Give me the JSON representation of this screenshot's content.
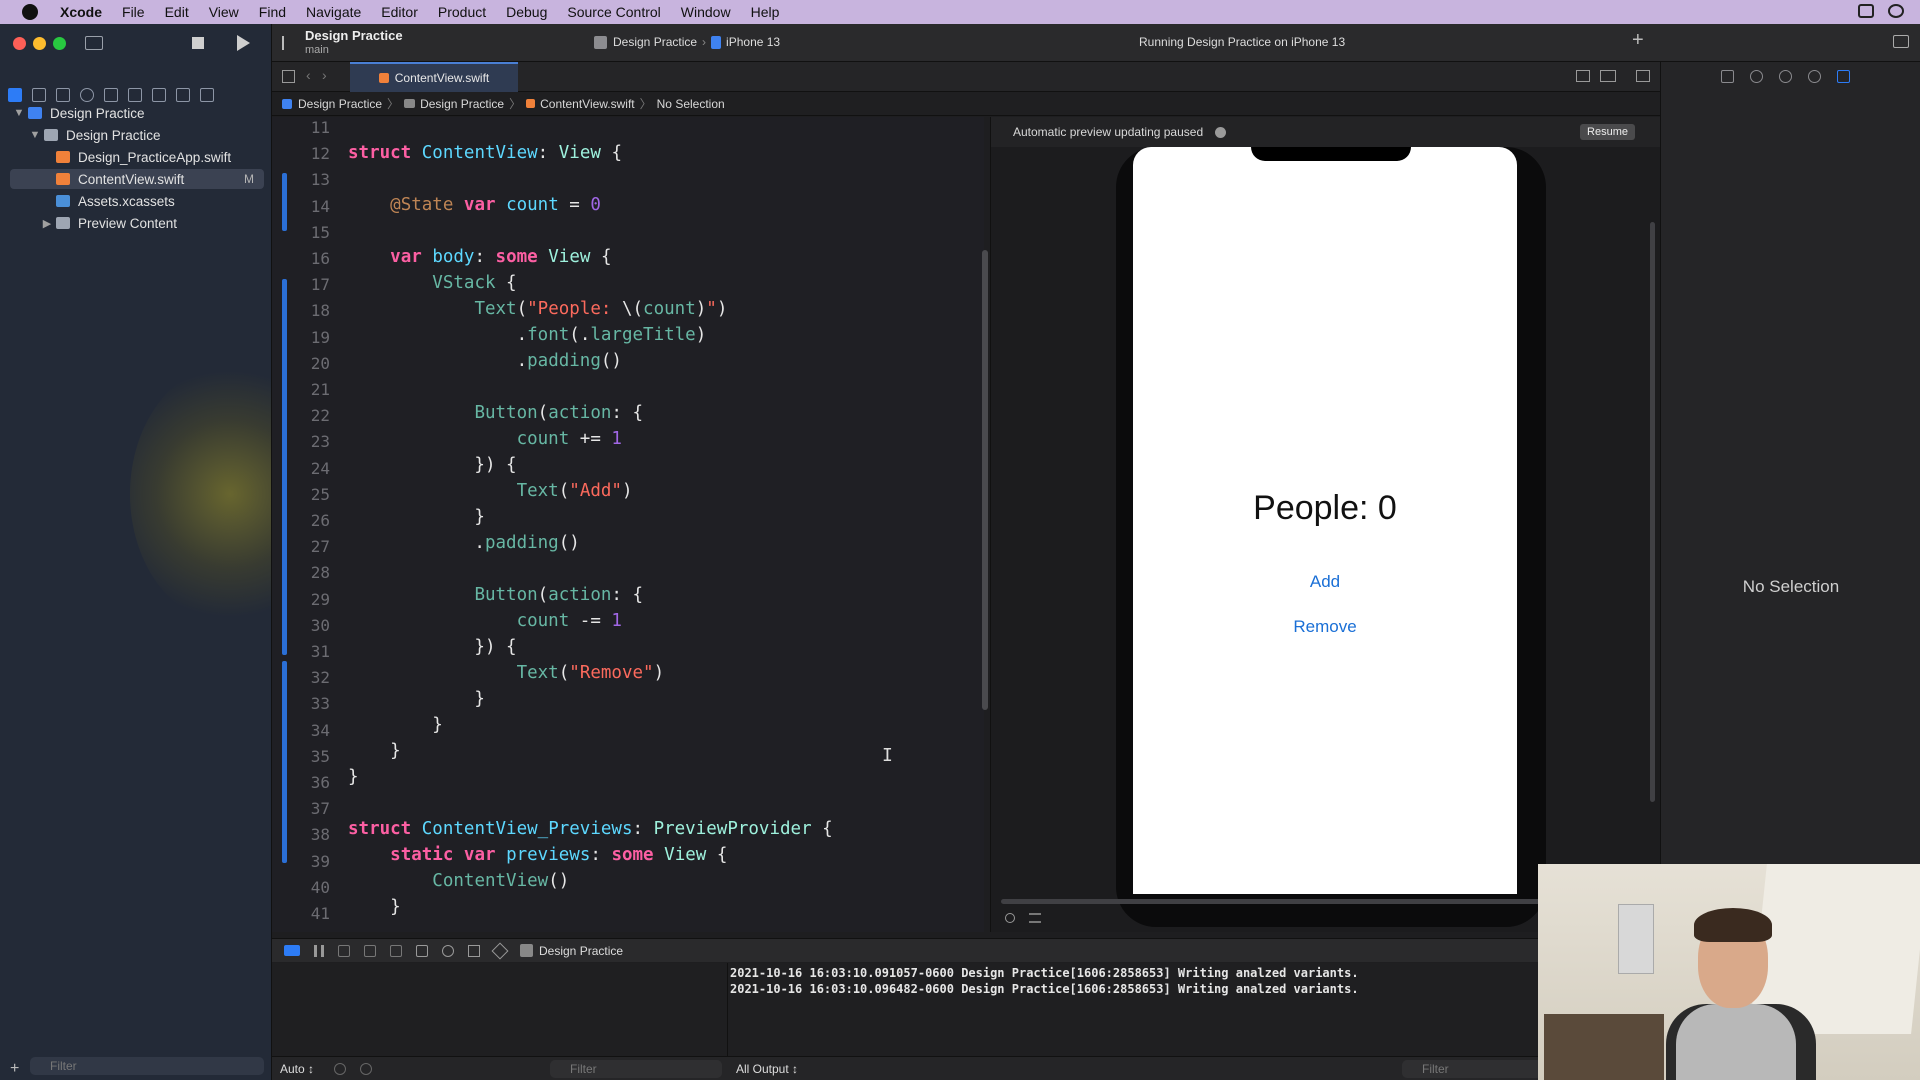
{
  "menubar": {
    "app": "Xcode",
    "items": [
      "File",
      "Edit",
      "View",
      "Find",
      "Navigate",
      "Editor",
      "Product",
      "Debug",
      "Source Control",
      "Window",
      "Help"
    ]
  },
  "toolbar": {
    "project_title": "Design Practice",
    "branch": "main",
    "scheme": "Design Practice",
    "device": "iPhone 13",
    "status": "Running Design Practice on iPhone 13"
  },
  "navigator": {
    "items": [
      {
        "label": "Design Practice",
        "kind": "project"
      },
      {
        "label": "Design Practice",
        "kind": "folder"
      },
      {
        "label": "Design_PracticeApp.swift",
        "kind": "swift"
      },
      {
        "label": "ContentView.swift",
        "kind": "swift",
        "badge": "M"
      },
      {
        "label": "Assets.xcassets",
        "kind": "assets"
      },
      {
        "label": "Preview Content",
        "kind": "folder"
      }
    ],
    "filter_placeholder": "Filter"
  },
  "tabs": [
    {
      "label": "ContentView.swift"
    }
  ],
  "breadcrumb": [
    "Design Practice",
    "Design Practice",
    "ContentView.swift",
    "No Selection"
  ],
  "editor": {
    "line_numbers": [
      "11",
      "12",
      "13",
      "14",
      "15",
      "16",
      "17",
      "18",
      "19",
      "20",
      "21",
      "22",
      "23",
      "24",
      "25",
      "26",
      "27",
      "28",
      "29",
      "30",
      "31",
      "32",
      "33",
      "34",
      "35",
      "36",
      "37",
      "38",
      "39",
      "40",
      "41"
    ]
  },
  "preview": {
    "header": "Automatic preview updating paused",
    "resume_label": "Resume",
    "people_text": "People: 0",
    "add_label": "Add",
    "remove_label": "Remove"
  },
  "inspector": {
    "empty_label": "No Selection"
  },
  "debug": {
    "scheme": "Design Practice",
    "console_lines": [
      "2021-10-16 16:03:10.091057-0600 Design Practice[1606:2858653] Writing analzed variants.",
      "2021-10-16 16:03:10.096482-0600 Design Practice[1606:2858653] Writing analzed variants."
    ],
    "auto_label": "Auto ↕",
    "filter_placeholder": "Filter",
    "output_label": "All Output ↕"
  },
  "colors": {
    "accent": "#2d7cf6",
    "change_bar": "#2b6fd6",
    "keyword": "#fc5fa3",
    "type": "#5dd8ff",
    "string": "#fc6a5d",
    "number": "#d0bf69",
    "menubar": "#c8b4de"
  }
}
